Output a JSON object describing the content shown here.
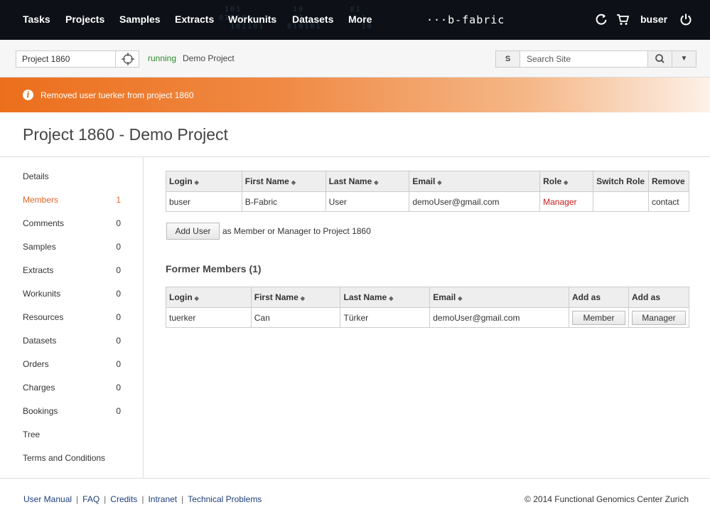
{
  "nav": {
    "items": [
      "Tasks",
      "Projects",
      "Samples",
      "Extracts",
      "Workunits",
      "Datasets",
      "More"
    ],
    "logo": "···b-fabric",
    "user": "buser"
  },
  "subbar": {
    "project_value": "Project 1860",
    "status": "running",
    "project_name": "Demo Project",
    "search_scope": "S",
    "search_placeholder": "Search Site"
  },
  "alert": {
    "message": "Removed user tuerker from project 1860"
  },
  "page": {
    "title": "Project 1860 - Demo Project"
  },
  "sidebar": {
    "items": [
      {
        "label": "Details",
        "count": ""
      },
      {
        "label": "Members",
        "count": "1"
      },
      {
        "label": "Comments",
        "count": "0"
      },
      {
        "label": "Samples",
        "count": "0"
      },
      {
        "label": "Extracts",
        "count": "0"
      },
      {
        "label": "Workunits",
        "count": "0"
      },
      {
        "label": "Resources",
        "count": "0"
      },
      {
        "label": "Datasets",
        "count": "0"
      },
      {
        "label": "Orders",
        "count": "0"
      },
      {
        "label": "Charges",
        "count": "0"
      },
      {
        "label": "Bookings",
        "count": "0"
      },
      {
        "label": "Tree",
        "count": ""
      },
      {
        "label": "Terms and Conditions",
        "count": ""
      }
    ],
    "active": "Members"
  },
  "members": {
    "headers": [
      "Login",
      "First Name",
      "Last Name",
      "Email",
      "Role",
      "Switch Role",
      "Remove"
    ],
    "rows": [
      {
        "login": "buser",
        "first": "B-Fabric",
        "last": "User",
        "email": "demoUser@gmail.com",
        "role": "Manager",
        "switch": "",
        "remove": "contact"
      }
    ],
    "add_button": "Add User",
    "add_text": "as Member or Manager to Project 1860"
  },
  "former": {
    "title": "Former Members (1)",
    "headers": [
      "Login",
      "First Name",
      "Last Name",
      "Email",
      "Add as",
      "Add as"
    ],
    "rows": [
      {
        "login": "tuerker",
        "first": "Can",
        "last": "Türker",
        "email": "demoUser@gmail.com",
        "member_btn": "Member",
        "manager_btn": "Manager"
      }
    ]
  },
  "footer": {
    "links": [
      "User Manual",
      "FAQ",
      "Credits",
      "Intranet",
      "Technical Problems"
    ],
    "copyright": "© 2014 Functional Genomics Center Zurich"
  },
  "colors": {
    "accent": "#ec6f1c",
    "nav_bg": "#0d1117",
    "role_manager": "#c61a1a",
    "status_running": "#2e8b2e",
    "link": "#1d3f7a"
  }
}
